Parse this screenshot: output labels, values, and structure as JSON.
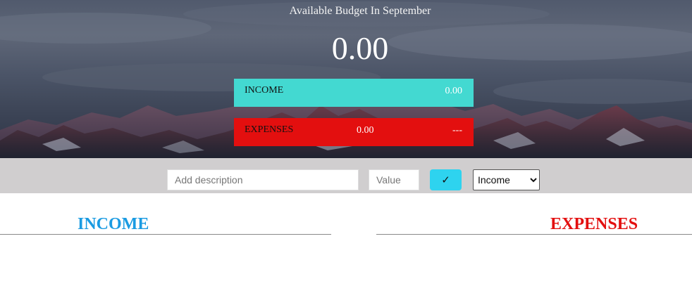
{
  "header": {
    "title": "Available Budget In September",
    "budget": "0.00"
  },
  "summary": {
    "income": {
      "label": "INCOME",
      "value": "0.00",
      "color": "#43d9d1"
    },
    "expenses": {
      "label": "EXPENSES",
      "value": "0.00",
      "percentage": "---",
      "color": "#e30f0f"
    }
  },
  "input_bar": {
    "description_placeholder": "Add description",
    "value_placeholder": "Value",
    "add_button_label": "✓",
    "add_button_icon": "checkmark-icon",
    "type_select": {
      "selected": "Income",
      "options": [
        "Income"
      ]
    }
  },
  "lists": {
    "income_title": "INCOME",
    "income_color": "#1a9be2",
    "expenses_title": "EXPENSES",
    "expenses_color": "#e30f0f"
  }
}
